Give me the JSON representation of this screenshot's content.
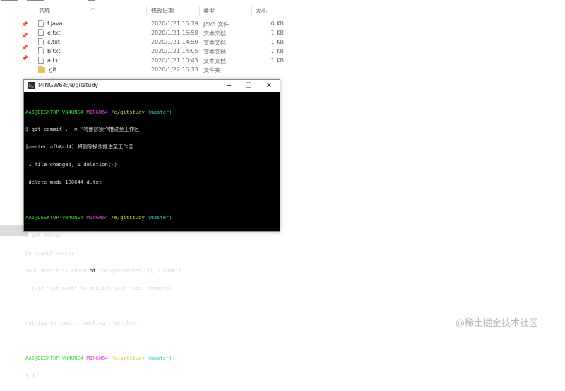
{
  "explorer": {
    "columns": {
      "name": "名称",
      "date": "修改日期",
      "type": "类型",
      "size": "大小"
    },
    "files": [
      {
        "name": "f.java",
        "date": "2020/1/21 15:19",
        "type": "JAVA 文件",
        "size": "0 KB",
        "kind": "file"
      },
      {
        "name": "e.txt",
        "date": "2020/1/21 15:58",
        "type": "文本文档",
        "size": "1 KB",
        "kind": "file"
      },
      {
        "name": "c.txt",
        "date": "2020/1/21 14:50",
        "type": "文本文档",
        "size": "1 KB",
        "kind": "file"
      },
      {
        "name": "b.txt",
        "date": "2020/1/21 14:05",
        "type": "文本文档",
        "size": "1 KB",
        "kind": "file"
      },
      {
        "name": "a.txt",
        "date": "2020/1/21 10:43",
        "type": "文本文档",
        "size": "1 KB",
        "kind": "file"
      },
      {
        "name": ".git",
        "date": "2020/1/22 15:13",
        "type": "文件夹",
        "size": "",
        "kind": "folder"
      }
    ]
  },
  "terminal": {
    "title": "MINGW64:/e/gitstudy",
    "prompt": {
      "user": "AA5@DESKTOP-VN4UNS4",
      "env": "MINGW64",
      "path": "/e/gitstudy",
      "branch": "(master)"
    },
    "commit_cmd": "$ git commit . -m '将删除操作推进至工作区'",
    "commit_out": [
      "[master afb8cd4] 将删除操作推进至工作区",
      " 1 file changed, 1 deletion(-)",
      " delete mode 100644 d.txt"
    ],
    "status_cmd": "$ git status",
    "status_out1": "On branch master",
    "ahead_pre": "Your branch is ahead ",
    "ahead_hl": "of",
    "ahead_post": " 'origin/master' by 1 commit.",
    "status_out3": "  (use \"git push\" to publish your local commits)",
    "status_out4": "nothing to commit, working tree clean",
    "final_prompt": "$ "
  },
  "watermark": "@稀土掘金技术社区"
}
